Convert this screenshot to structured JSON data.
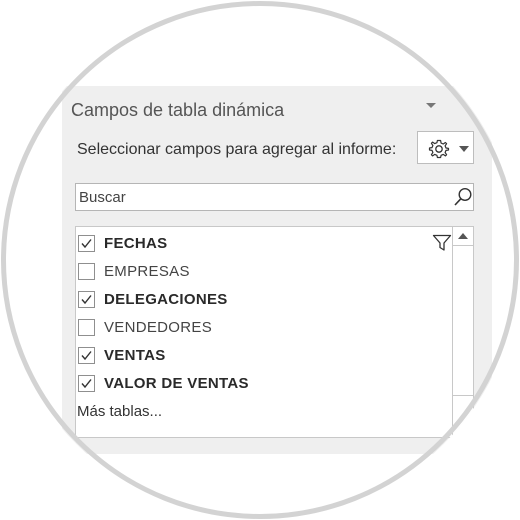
{
  "pane": {
    "title": "Campos de tabla dinámica",
    "prompt": "Seleccionar campos para agregar al informe:",
    "settings_icon": "gear-icon"
  },
  "search": {
    "placeholder": "Buscar",
    "value": "",
    "icon": "search-icon"
  },
  "fields": [
    {
      "label": "FECHAS",
      "checked": true,
      "filtered": true
    },
    {
      "label": "EMPRESAS",
      "checked": false,
      "filtered": false
    },
    {
      "label": "DELEGACIONES",
      "checked": true,
      "filtered": false
    },
    {
      "label": "VENDEDORES",
      "checked": false,
      "filtered": false
    },
    {
      "label": "VENTAS",
      "checked": true,
      "filtered": false
    },
    {
      "label": "VALOR DE VENTAS",
      "checked": true,
      "filtered": false
    }
  ],
  "more_tables": "Más tablas...",
  "colors": {
    "pane_bg": "#efefef",
    "ring": "#d3d3d3",
    "text": "#444444"
  }
}
